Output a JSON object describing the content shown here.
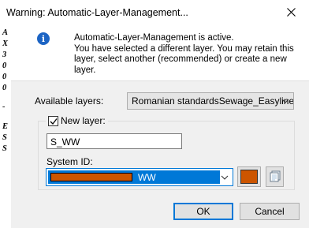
{
  "window": {
    "title": "Warning: Automatic-Layer-Management..."
  },
  "side_strip": {
    "letters": [
      "A",
      "X",
      "3",
      "0",
      "0",
      "0",
      "-",
      "E",
      "S",
      "S"
    ]
  },
  "info": {
    "icon": "info-icon",
    "message_lines": [
      "Automatic-Layer-Management is active.",
      "You have selected a different layer. You may retain this",
      "layer, select another (recommended) or create a new",
      "layer."
    ]
  },
  "available_layers": {
    "label": "Available layers:",
    "selected": "Romanian standardsSewage_Easyline"
  },
  "new_layer": {
    "label": "New layer:",
    "checked": true,
    "value": "S_WW"
  },
  "system_id": {
    "label": "System ID:",
    "selected": "WW",
    "color": "#cc5500"
  },
  "buttons": {
    "ok": "OK",
    "cancel": "Cancel"
  },
  "colors": {
    "accent": "#0078d7",
    "system_color": "#cc5500",
    "info_icon": "#1c64c4"
  }
}
